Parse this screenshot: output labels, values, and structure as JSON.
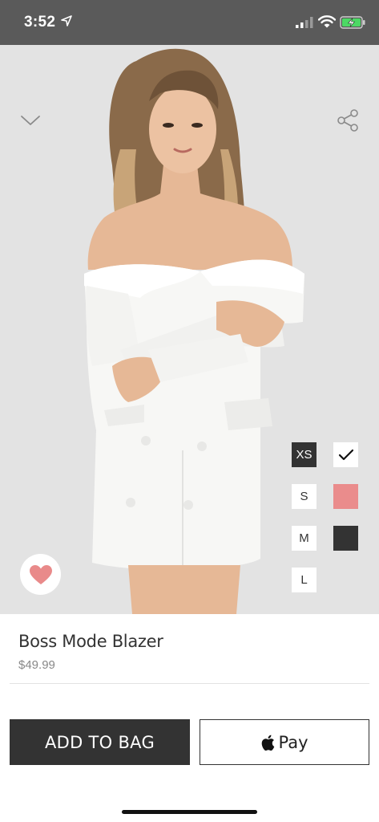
{
  "status_bar": {
    "time": "3:52",
    "icons": [
      "location-arrow-icon",
      "cellular-signal-icon",
      "wifi-icon",
      "battery-charging-icon"
    ]
  },
  "hero": {
    "image_alt": "Model wearing white off-shoulder blazer dress",
    "icons": [
      "chevron-down-icon",
      "share-icon",
      "heart-icon"
    ]
  },
  "sizes": [
    {
      "label": "XS",
      "selected": true
    },
    {
      "label": "S",
      "selected": false
    },
    {
      "label": "M",
      "selected": false
    },
    {
      "label": "L",
      "selected": false
    }
  ],
  "colors": [
    {
      "hex": "#ffffff",
      "selected": true
    },
    {
      "hex": "#ea8c8c",
      "selected": false
    },
    {
      "hex": "#333333",
      "selected": false
    }
  ],
  "product": {
    "name": "Boss Mode Blazer",
    "price": "$49.99"
  },
  "actions": {
    "add_to_bag": "ADD TO BAG",
    "apple_pay": "Pay"
  },
  "theme": {
    "favorite_color": "#e98a8a",
    "dark": "#333333"
  }
}
